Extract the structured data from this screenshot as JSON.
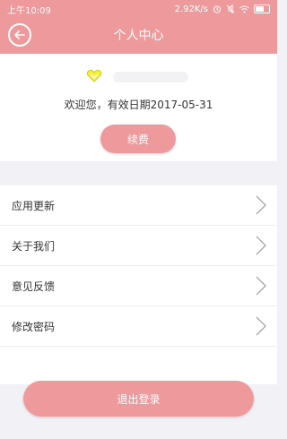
{
  "status_bar": {
    "time": "上午10:09",
    "network_speed": "2.92K/s",
    "icons": [
      "alarm-icon",
      "mute-icon",
      "wifi-icon",
      "battery-icon"
    ]
  },
  "header": {
    "title": "个人中心",
    "back_icon": "back-arrow-icon"
  },
  "profile": {
    "vip_icon": "heart-badge-icon",
    "welcome_text": "欢迎您，有效日期2017-05-31",
    "renew_label": "续费"
  },
  "menu": {
    "items": [
      {
        "label": "应用更新"
      },
      {
        "label": "关于我们"
      },
      {
        "label": "意见反馈"
      },
      {
        "label": "修改密码"
      }
    ]
  },
  "footer": {
    "logout_label": "退出登录"
  },
  "colors": {
    "accent": "#ee9a9c",
    "background": "#f2f1f6"
  }
}
